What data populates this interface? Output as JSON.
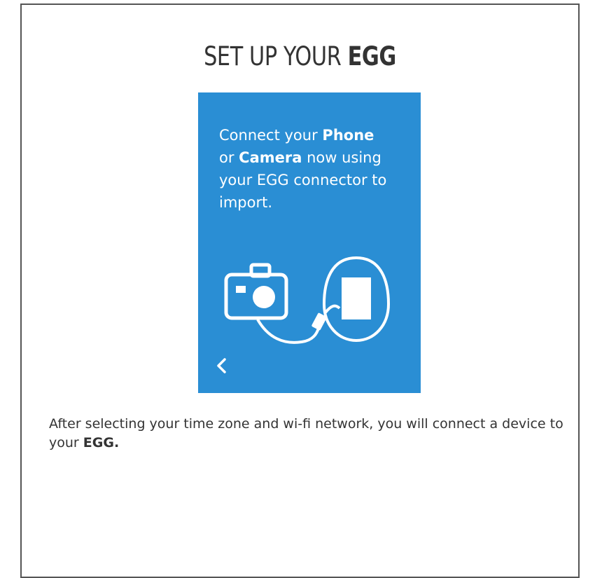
{
  "header": {
    "title_prefix": "SET UP YOUR",
    "title_bold": "EGG"
  },
  "device_screen": {
    "text_part1": "Connect your",
    "phone_word": "Phone",
    "text_part2": "or",
    "camera_word": "Camera",
    "text_part3": "now using your EGG connector to import.",
    "background_color": "#2a8ed4",
    "icons": [
      "camera-icon",
      "phone-icon",
      "cable-icon",
      "back-arrow-icon"
    ]
  },
  "caption": {
    "text": "After selecting your time zone and wi-fi network, you will connect a device to your",
    "bold": "EGG."
  }
}
